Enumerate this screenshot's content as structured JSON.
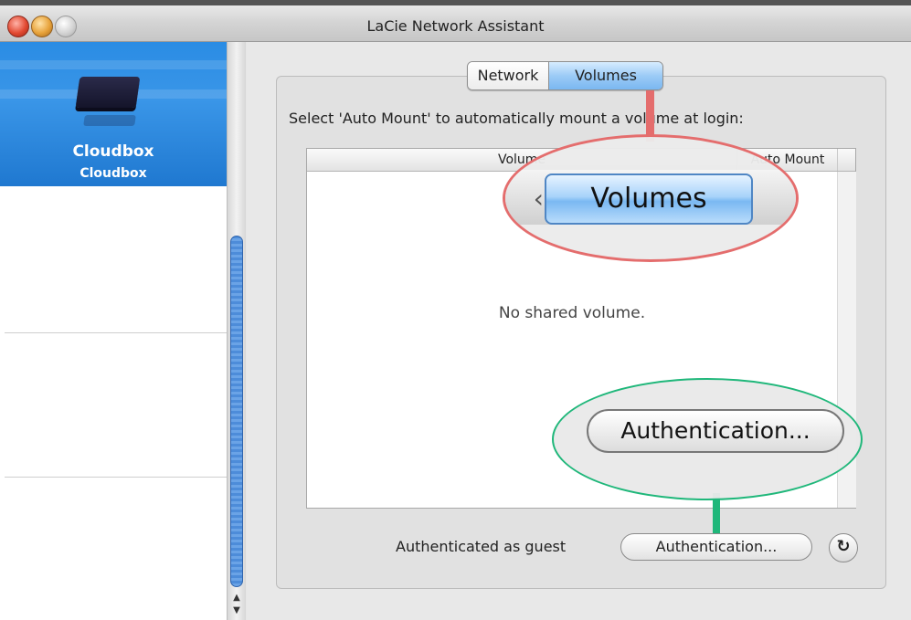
{
  "window": {
    "title": "LaCie Network Assistant"
  },
  "sidebar": {
    "device": {
      "name": "Cloudbox",
      "subtitle": "Cloudbox"
    }
  },
  "tabs": [
    {
      "label": "Network",
      "selected": false
    },
    {
      "label": "Volumes",
      "selected": true
    }
  ],
  "main": {
    "instruction": "Select 'Auto Mount' to automatically mount a volume at login:",
    "table": {
      "columns": [
        "Volume",
        "Auto Mount"
      ],
      "empty_message": "No shared volume."
    },
    "auth_status": "Authenticated as guest",
    "auth_button_label": "Authentication...",
    "refresh_icon": "refresh-icon"
  },
  "callouts": {
    "volumes_zoom_label": "Volumes",
    "auth_zoom_label": "Authentication...",
    "colors": {
      "red": "#e46d6d",
      "green": "#1fb77a"
    }
  },
  "colors": {
    "selection_blue": "#2a8ce4",
    "tab_selected": "#9ccbf6"
  }
}
